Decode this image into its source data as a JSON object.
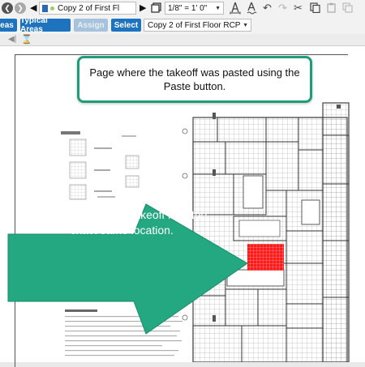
{
  "toolbar": {
    "page_combo_value": "Copy 2 of First Fl",
    "scale_value": "1/8\" = 1' 0\"",
    "areas_label": "eas",
    "typical_areas_label": "Typical Areas",
    "assign_label": "Assign",
    "select_label": "Select",
    "page_select_value": "Copy 2 of First Floor RCP"
  },
  "callouts": {
    "top_text": "Page where the takeoff was pasted using the Paste button.",
    "arrow_text": "Notice, the pasted takeoff is in the exact same location."
  },
  "colors": {
    "accent_blue": "#1e73be",
    "callout_green": "#1f9d79",
    "arrow_green": "#23a882",
    "takeoff_red": "#ff1a1a"
  }
}
